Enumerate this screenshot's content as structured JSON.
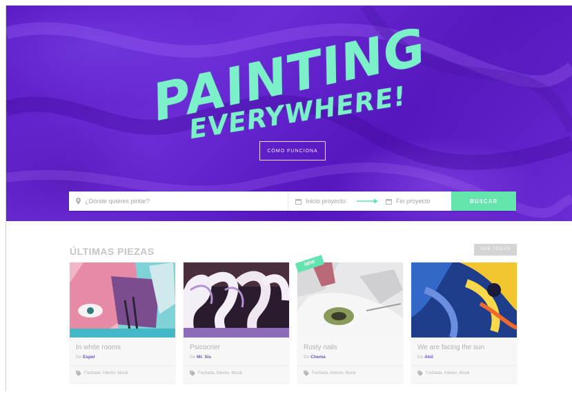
{
  "hero": {
    "title_line1": "PAINTING",
    "title_line2": "EVERYWHERE!",
    "how_it_works_label": "CÓMO FUNCIONA"
  },
  "search": {
    "where_placeholder": "¿Dónde quieres pintar?",
    "start_placeholder": "Inicio proyecto",
    "end_placeholder": "Fin proyecto",
    "button_label": "BUSCAR"
  },
  "section": {
    "title": "ÚLTIMAS PIEZAS",
    "see_all_label": "VER TODAS"
  },
  "cards": [
    {
      "name": "In white rooms",
      "by_prefix": "De",
      "artist": "Espel",
      "tags": "Fachada, Interior, Mural",
      "badge": ""
    },
    {
      "name": "Psicocrier",
      "by_prefix": "De",
      "artist": "Mr. Sis",
      "tags": "Fachada, Interior, Mural",
      "badge": ""
    },
    {
      "name": "Rusty nails",
      "by_prefix": "De",
      "artist": "Chema",
      "tags": "Fachada, Interior, Mural",
      "badge": "NEW"
    },
    {
      "name": "We are facing the sun",
      "by_prefix": "De",
      "artist": "Atol",
      "tags": "Fachada, Interior, Mural",
      "badge": ""
    }
  ],
  "colors": {
    "hero_purple": "#5f22c8",
    "title_mint": "#7cf0c8",
    "search_button": "#62e6ab",
    "artist_link": "#6d50c8"
  },
  "icons": {
    "where": "location-pin-icon",
    "start": "calendar-icon",
    "end": "calendar-icon",
    "arrow": "arrow-right-icon",
    "tag": "tag-icon"
  }
}
